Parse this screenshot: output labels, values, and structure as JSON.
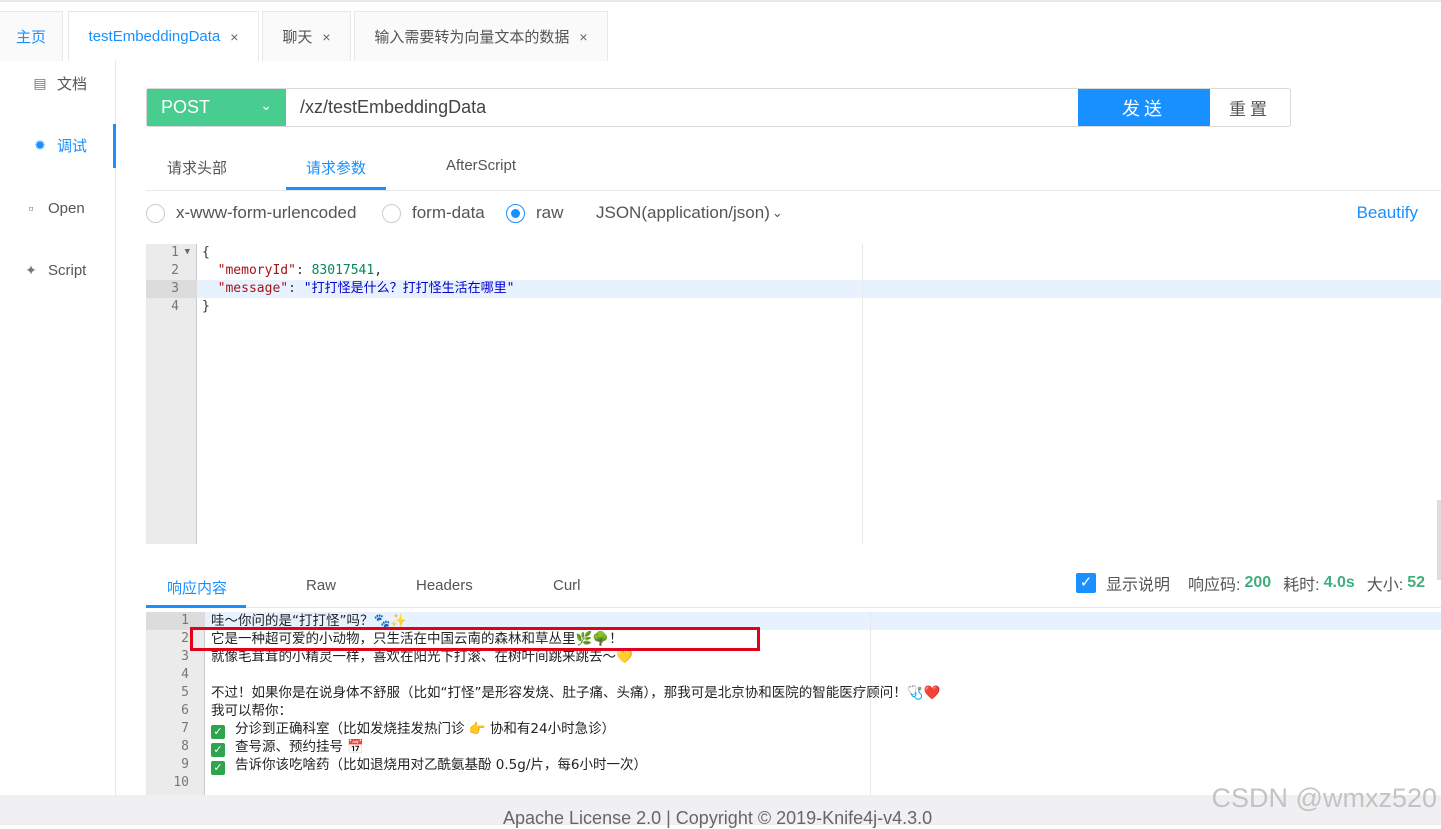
{
  "tabs": [
    {
      "label": "主页"
    },
    {
      "label": "testEmbeddingData",
      "close": "×"
    },
    {
      "label": "聊天",
      "close": "×"
    },
    {
      "label": "输入需要转为向量文本的数据",
      "close": "×"
    }
  ],
  "sidebar": {
    "items": [
      {
        "label": "文档",
        "icon": "document-icon"
      },
      {
        "label": "调试",
        "icon": "bug-icon"
      },
      {
        "label": "Open",
        "icon": "file-icon"
      },
      {
        "label": "Script",
        "icon": "code-icon"
      }
    ]
  },
  "request": {
    "method": "POST",
    "url": "/xz/testEmbeddingData",
    "send_label": "发送",
    "reset_label": "重置"
  },
  "req_tabs": [
    "请求头部",
    "请求参数",
    "AfterScript"
  ],
  "body_types": {
    "urlencoded": "x-www-form-urlencoded",
    "formdata": "form-data",
    "raw": "raw",
    "content_type": "JSON(application/json)",
    "beautify": "Beautify"
  },
  "editor": {
    "line_numbers": [
      "1",
      "2",
      "3",
      "4"
    ],
    "lines": {
      "l1": "{",
      "l2_key": "\"memoryId\"",
      "l2_sep": ": ",
      "l2_val": "83017541",
      "l2_end": ",",
      "l3_key": "\"message\"",
      "l3_sep": ": ",
      "l3_val": "\"打打怪是什么？打打怪生活在哪里\"",
      "l4": "}"
    }
  },
  "response": {
    "tabs": [
      "响应内容",
      "Raw",
      "Headers",
      "Curl"
    ],
    "show_desc": "显示说明",
    "code_label": "响应码:",
    "code": "200",
    "time_label": "耗时:",
    "time": "4.0s",
    "size_label": "大小:",
    "size": "52",
    "line_numbers": [
      "1",
      "2",
      "3",
      "4",
      "5",
      "6",
      "7",
      "8",
      "9",
      "10"
    ],
    "lines": [
      "哇～你问的是“打打怪”吗？🐾✨",
      "它是一种超可爱的小动物，只生活在中国云南的森林和草丛里🌿🌳！",
      "就像毛茸茸的小精灵一样，喜欢在阳光下打滚、在树叶间跳来跳去～💛",
      "",
      "不过！如果你是在说身体不舒服（比如“打怪”是形容发烧、肚子痛、头痛），那我可是北京协和医院的智能医疗顾问！🩺❤️",
      "我可以帮你：",
      "分诊到正确科室（比如发烧挂发热门诊 👉 协和有24小时急诊）",
      "查号源、预约挂号 📅",
      "告诉你该吃啥药（比如退烧用对乙酰氨基酚 0.5g/片，每6小时一次）",
      ""
    ]
  },
  "footer": {
    "text": "Apache License 2.0 | Copyright © 2019-Knife4j-v4.3.0"
  },
  "watermark": "CSDN @wmxz520",
  "colors": {
    "accent": "#1890ff",
    "method": "#49cc90",
    "success": "#3eaf7c",
    "highlight_box": "#e3001b"
  }
}
